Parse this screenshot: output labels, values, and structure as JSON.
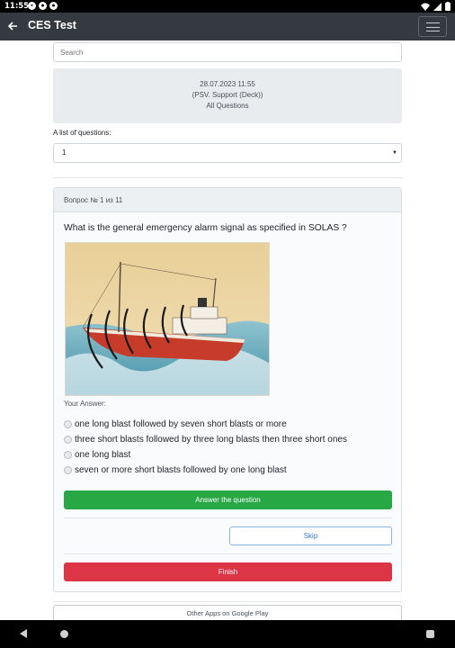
{
  "status_bar": {
    "time": "11:55",
    "left_icons": [
      "notification-icon",
      "app-icon",
      "app-icon"
    ],
    "right_icons": [
      "wifi-icon",
      "signal-icon",
      "battery-icon"
    ]
  },
  "app_bar": {
    "title": "CES Test",
    "back_icon": "arrow-left-icon",
    "menu_icon": "hamburger-icon"
  },
  "search": {
    "placeholder": "Search",
    "value": ""
  },
  "test_info": {
    "datetime": "28.07.2023 11:55",
    "category": "(PSV. Support (Deck))",
    "scope": "All Questions"
  },
  "question_list": {
    "label": "A list of questions:",
    "selected": "1"
  },
  "question_card": {
    "header": "Вопрос № 1 из 11",
    "question": "What is the general emergency alarm signal as specified in SOLAS ?",
    "your_answer_label": "Your Answer:",
    "options": [
      "one long blast followed by seven short blasts or more",
      "three short blasts followed by three long blasts then three short ones",
      "one long blast",
      "seven or more short blasts followed by one long blast"
    ],
    "answer_button": "Answer the question",
    "skip_button": "Skip",
    "finish_button": "Finish"
  },
  "footer": {
    "other_apps": "Other Apps on Google Play"
  },
  "colors": {
    "app_bar": "#343a40",
    "success": "#28a745",
    "danger": "#dc3545",
    "primary_outline": "#3a78c2"
  }
}
